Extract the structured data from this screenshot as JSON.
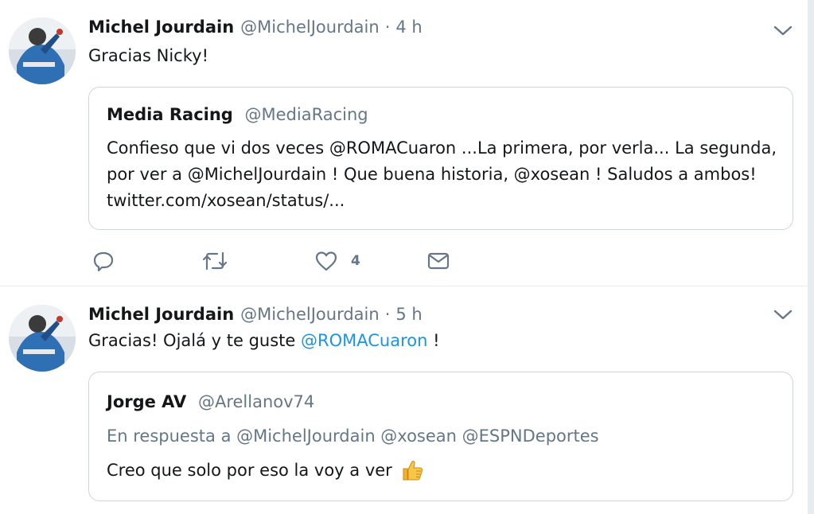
{
  "tweets": [
    {
      "fullname": "Michel Jourdain",
      "username": "@MichelJourdain",
      "separator": "·",
      "time": "4 h",
      "text": "Gracias Nicky!",
      "quote": {
        "fullname": "Media Racing",
        "username": "@MediaRacing",
        "text": "Confieso que vi dos veces @ROMACuaron ...La primera, por verla... La segunda, por ver a @MichelJourdain ! Que buena historia, @xosean ! Saludos a ambos! twitter.com/xosean/status/..."
      },
      "actions": {
        "reply_icon": "reply-icon",
        "retweet_icon": "retweet-icon",
        "like_icon": "heart-icon",
        "like_count": "4",
        "dm_icon": "envelope-icon"
      }
    },
    {
      "fullname": "Michel Jourdain",
      "username": "@MichelJourdain",
      "separator": "·",
      "time": "5 h",
      "text_before": "Gracias! Ojalá y te guste ",
      "text_mention": "@ROMACuaron",
      "text_after": " !",
      "quote": {
        "fullname": "Jorge AV",
        "username": "@Arellanov74",
        "reply_context": "En respuesta a @MichelJourdain @xosean @ESPNDeportes",
        "text": "Creo que solo por eso la voy a ver",
        "emoji": "thumbs-up-icon"
      }
    }
  ],
  "colors": {
    "link": "#1b95e0",
    "secondary_text": "#657786",
    "border": "#e6ecf0"
  }
}
